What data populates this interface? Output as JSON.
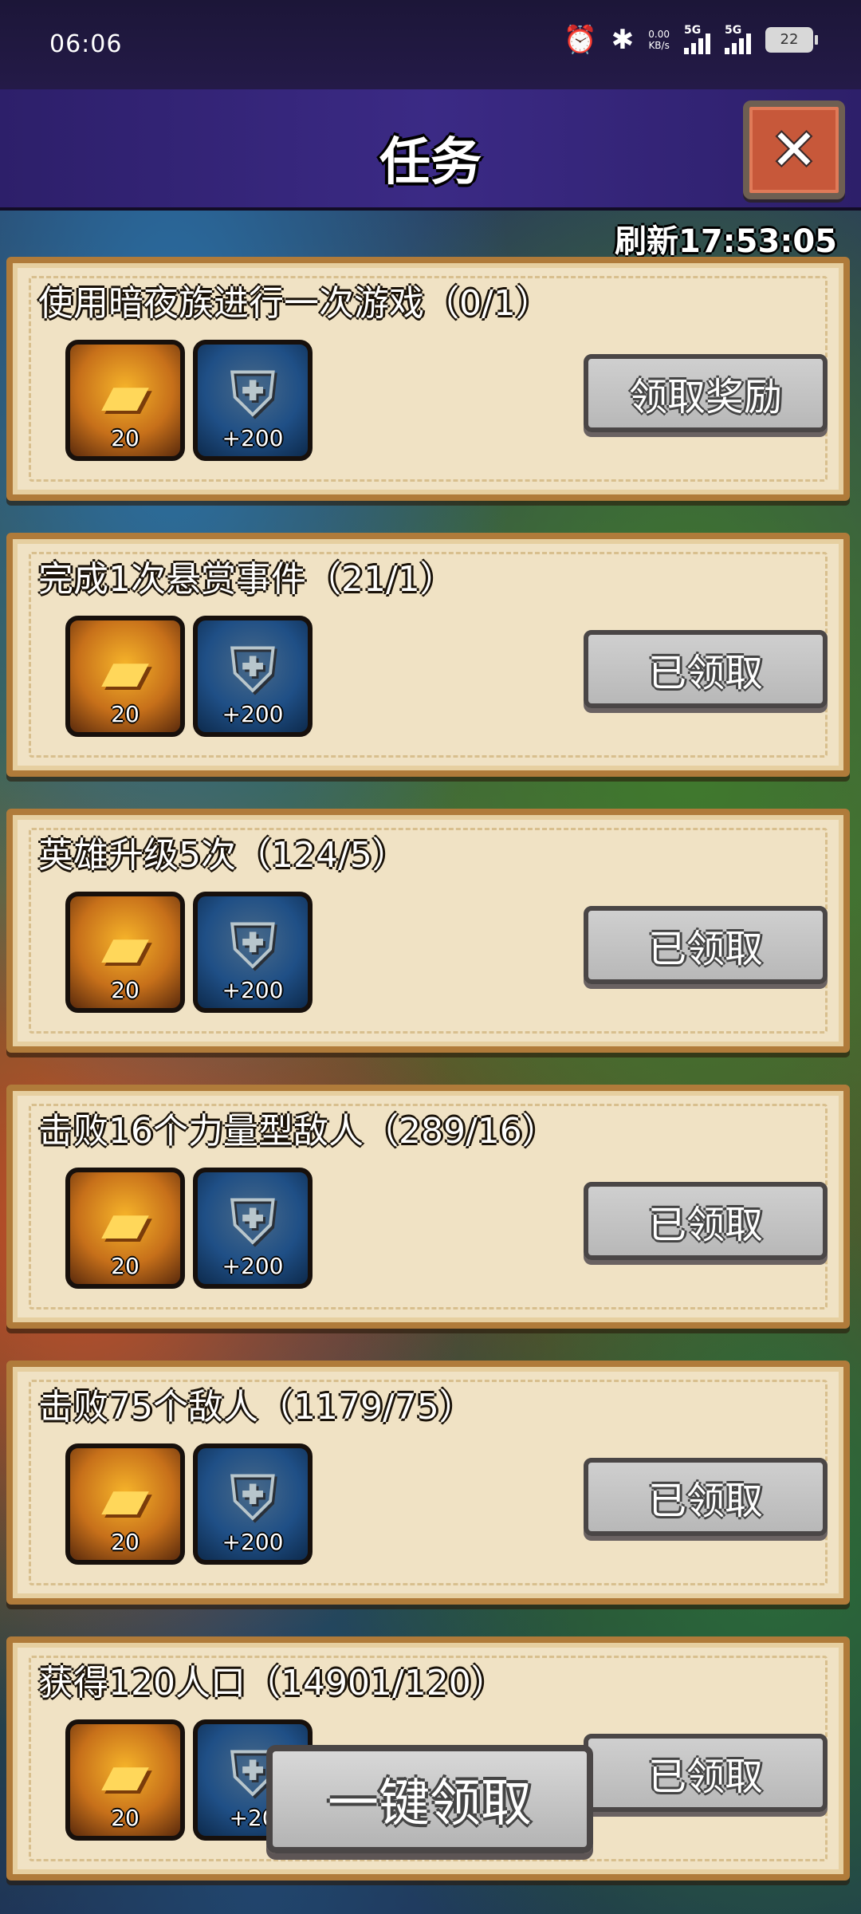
{
  "status_bar": {
    "time": "06:06",
    "alarm_icon": "alarm-clock-icon",
    "bluetooth_icon": "bluetooth-icon",
    "net_speed_value": "0.00",
    "net_speed_unit": "KB/s",
    "sim1_label": "5G",
    "sim2_label": "5G",
    "battery_level": "22"
  },
  "header": {
    "title": "任务",
    "close_icon": "close-icon"
  },
  "refresh_label": "刷新17:53:05",
  "tasks": [
    {
      "title": "使用暗夜族进行一次游戏（0/1）",
      "rewards": [
        {
          "icon": "gold-bar-icon",
          "amount": "20"
        },
        {
          "icon": "shield-icon",
          "amount": "+200"
        }
      ],
      "button": "领取奖励"
    },
    {
      "title": "完成1次悬赏事件（21/1）",
      "rewards": [
        {
          "icon": "gold-bar-icon",
          "amount": "20"
        },
        {
          "icon": "shield-icon",
          "amount": "+200"
        }
      ],
      "button": "已领取"
    },
    {
      "title": "英雄升级5次（124/5）",
      "rewards": [
        {
          "icon": "gold-bar-icon",
          "amount": "20"
        },
        {
          "icon": "shield-icon",
          "amount": "+200"
        }
      ],
      "button": "已领取"
    },
    {
      "title": "击败16个力量型敌人（289/16）",
      "rewards": [
        {
          "icon": "gold-bar-icon",
          "amount": "20"
        },
        {
          "icon": "shield-icon",
          "amount": "+200"
        }
      ],
      "button": "已领取"
    },
    {
      "title": "击败75个敌人（1179/75）",
      "rewards": [
        {
          "icon": "gold-bar-icon",
          "amount": "20"
        },
        {
          "icon": "shield-icon",
          "amount": "+200"
        }
      ],
      "button": "已领取"
    },
    {
      "title": "获得120人口（14901/120）",
      "rewards": [
        {
          "icon": "gold-bar-icon",
          "amount": "20"
        },
        {
          "icon": "shield-icon",
          "amount": "+20"
        }
      ],
      "button": "已领取"
    }
  ],
  "claim_all_label": "一键领取"
}
